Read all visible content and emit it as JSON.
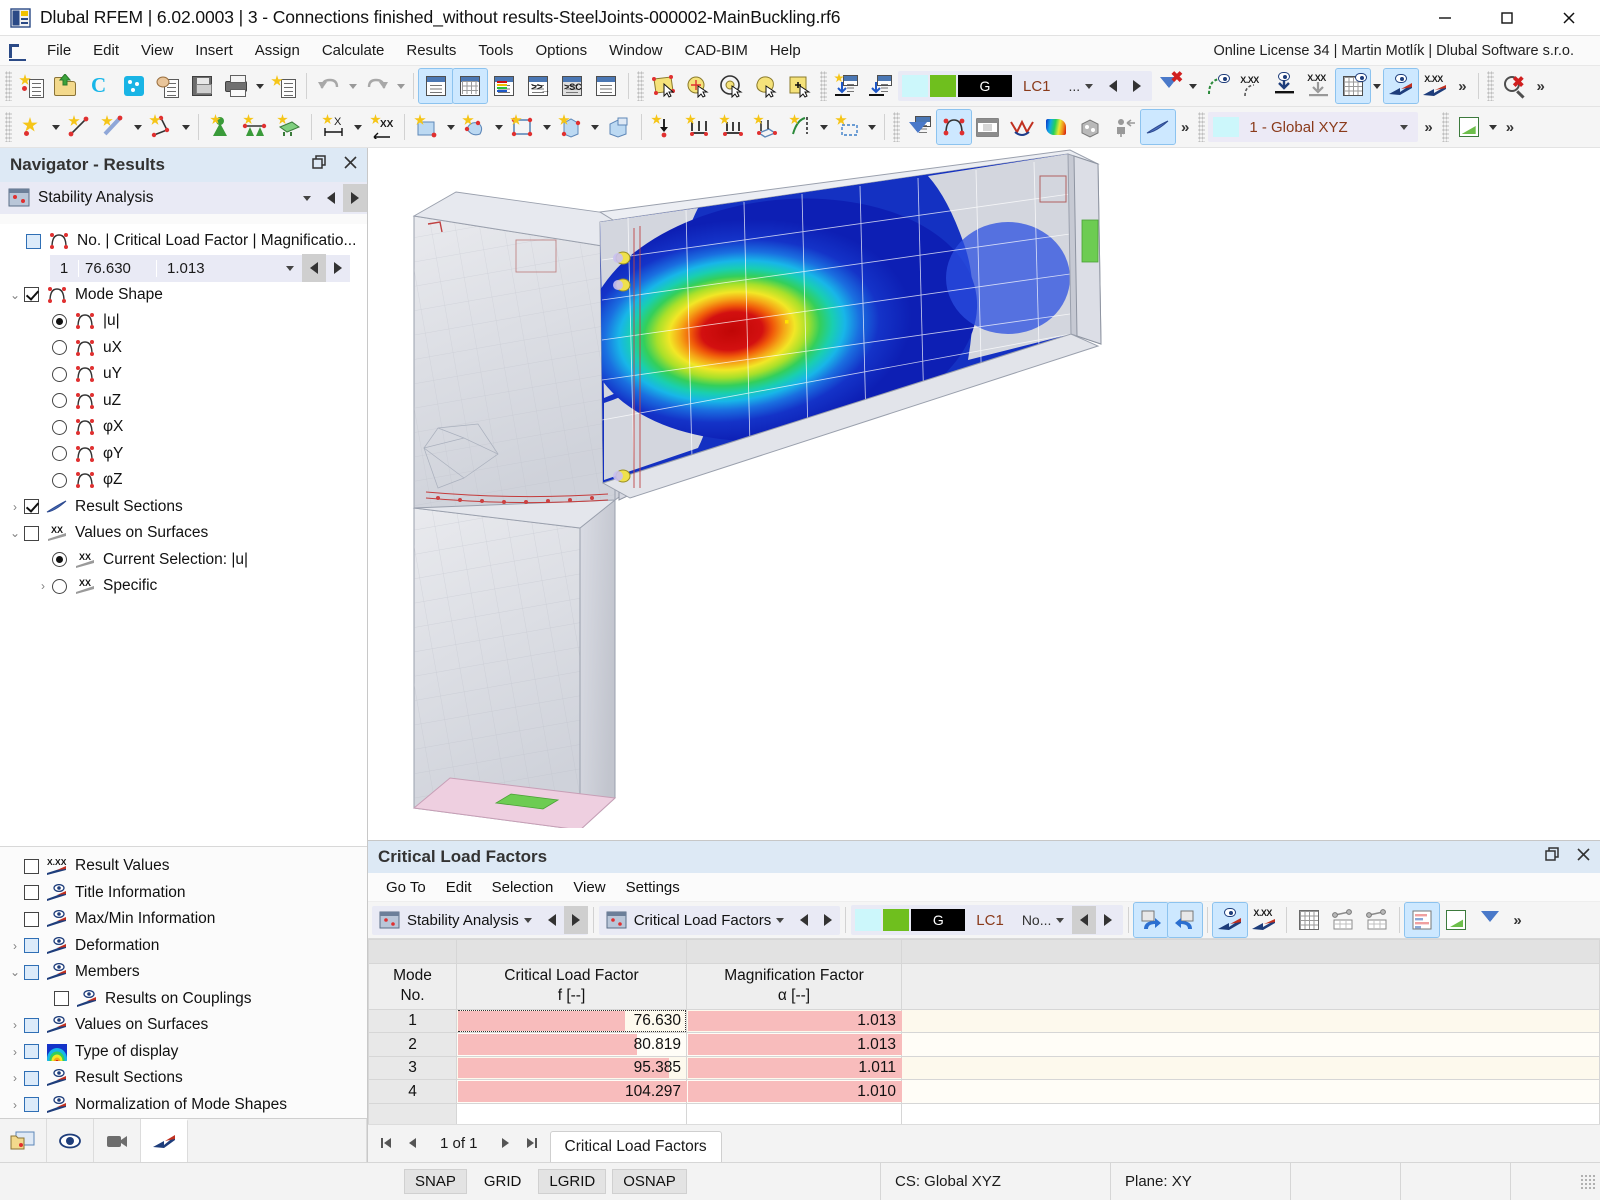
{
  "window": {
    "title": "Dlubal RFEM | 6.02.0003 | 3 - Connections finished_without results-SteelJoints-000002-MainBuckling.rf6",
    "minimize_label": "—",
    "maximize_label": "□",
    "close_label": "✕"
  },
  "menubar": {
    "items": [
      "File",
      "Edit",
      "View",
      "Insert",
      "Assign",
      "Calculate",
      "Results",
      "Tools",
      "Options",
      "Window",
      "CAD-BIM",
      "Help"
    ],
    "license": "Online License 34 | Martin Motlík | Dlubal Software s.r.o."
  },
  "toolbar": {
    "load_case": "LC1",
    "load_case_group": "G",
    "more_options": "...",
    "coordinate_system": "1 - Global XYZ",
    "overflow": "»"
  },
  "navigator": {
    "title": "Navigator - Results",
    "restore_icon": "restore-icon",
    "close_icon": "close-icon",
    "analysis_type": "Stability Analysis",
    "mode_header": "No. | Critical Load Factor | Magnificatio...",
    "selected_mode": {
      "no": "1",
      "critical_load_factor": "76.630",
      "magnification_factor": "1.013"
    },
    "tree": [
      {
        "label": "Mode Shape",
        "type": "checkbox",
        "checked": true,
        "expander": "⌄",
        "indent": 0,
        "icon": "member-icon"
      },
      {
        "label": "|u|",
        "type": "radio",
        "checked": true,
        "indent": 1,
        "icon": "member-icon"
      },
      {
        "label": "uX",
        "type": "radio",
        "checked": false,
        "indent": 1,
        "icon": "member-icon"
      },
      {
        "label": "uY",
        "type": "radio",
        "checked": false,
        "indent": 1,
        "icon": "member-icon"
      },
      {
        "label": "uZ",
        "type": "radio",
        "checked": false,
        "indent": 1,
        "icon": "member-icon"
      },
      {
        "label": "φX",
        "type": "radio",
        "checked": false,
        "indent": 1,
        "icon": "member-icon"
      },
      {
        "label": "φY",
        "type": "radio",
        "checked": false,
        "indent": 1,
        "icon": "member-icon"
      },
      {
        "label": "φZ",
        "type": "radio",
        "checked": false,
        "indent": 1,
        "icon": "member-icon"
      },
      {
        "label": "Result Sections",
        "type": "checkbox",
        "checked": true,
        "expander": "›",
        "indent": 0,
        "icon": "result-section-icon"
      },
      {
        "label": "Values on Surfaces",
        "type": "checkbox",
        "checked": false,
        "expander": "⌄",
        "indent": 0,
        "icon": "xx-icon"
      },
      {
        "label": "Current Selection: |u|",
        "type": "radio",
        "checked": true,
        "indent": 1,
        "icon": "xx-icon"
      },
      {
        "label": "Specific",
        "type": "radio",
        "checked": false,
        "expander": "›",
        "indent": 1,
        "icon": "xx-icon"
      }
    ],
    "lower_tree": [
      {
        "label": "Result Values",
        "checked": false,
        "blue": false,
        "expander": "",
        "indent": 0,
        "icon": "xxx-curve-icon"
      },
      {
        "label": "Title Information",
        "checked": false,
        "blue": false,
        "expander": "",
        "indent": 0,
        "icon": "eye-curve-icon"
      },
      {
        "label": "Max/Min Information",
        "checked": false,
        "blue": false,
        "expander": "",
        "indent": 0,
        "icon": "eye-curve-icon"
      },
      {
        "label": "Deformation",
        "checked": false,
        "blue": true,
        "expander": "›",
        "indent": 0,
        "icon": "eye-curve-icon"
      },
      {
        "label": "Members",
        "checked": false,
        "blue": true,
        "expander": "⌄",
        "indent": 0,
        "icon": "eye-curve-icon"
      },
      {
        "label": "Results on Couplings",
        "checked": false,
        "blue": false,
        "expander": "",
        "indent": 1,
        "icon": "eye-curve-icon"
      },
      {
        "label": "Values on Surfaces",
        "checked": false,
        "blue": true,
        "expander": "›",
        "indent": 0,
        "icon": "eye-curve-icon"
      },
      {
        "label": "Type of display",
        "checked": false,
        "blue": true,
        "expander": "›",
        "indent": 0,
        "icon": "rainbow-icon"
      },
      {
        "label": "Result Sections",
        "checked": false,
        "blue": true,
        "expander": "›",
        "indent": 0,
        "icon": "eye-curve-icon"
      },
      {
        "label": "Normalization of Mode Shapes",
        "checked": false,
        "blue": true,
        "expander": "›",
        "indent": 0,
        "icon": "eye-curve-icon"
      }
    ],
    "bottom_buttons": [
      "project-navigator-icon",
      "view-navigator-icon",
      "camera-icon",
      "results-navigator-icon"
    ]
  },
  "table_panel": {
    "title": "Critical Load Factors",
    "restore_icon": "restore-icon",
    "close_icon": "close-icon",
    "menu": [
      "Go To",
      "Edit",
      "Selection",
      "View",
      "Settings"
    ],
    "analysis_combo": "Stability Analysis",
    "table_combo": "Critical Load Factors",
    "load_case": "LC1",
    "load_case_group": "G",
    "no_label": "No...",
    "columns": [
      {
        "line1": "Mode",
        "line2": "No."
      },
      {
        "line1": "Critical Load Factor",
        "line2": "f [--]"
      },
      {
        "line1": "Magnification Factor",
        "line2": "α [--]"
      },
      {
        "line1": "",
        "line2": ""
      }
    ],
    "rows": [
      {
        "mode": "1",
        "critical_load_factor": "76.630",
        "magnification_factor": "1.013",
        "clf_bar_pct": 73,
        "mag_bar_pct": 100,
        "selected": true
      },
      {
        "mode": "2",
        "critical_load_factor": "80.819",
        "magnification_factor": "1.013",
        "clf_bar_pct": 78,
        "mag_bar_pct": 100,
        "selected": false
      },
      {
        "mode": "3",
        "critical_load_factor": "95.385",
        "magnification_factor": "1.011",
        "clf_bar_pct": 92,
        "mag_bar_pct": 100,
        "selected": false
      },
      {
        "mode": "4",
        "critical_load_factor": "104.297",
        "magnification_factor": "1.010",
        "clf_bar_pct": 100,
        "mag_bar_pct": 100,
        "selected": false
      }
    ],
    "pager": {
      "first": "⏮",
      "prev": "◀",
      "text": "1 of 1",
      "next": "▶",
      "last": "⏭"
    },
    "sheet_tab": "Critical Load Factors"
  },
  "statusbar": {
    "toggles": [
      "SNAP",
      "GRID",
      "LGRID",
      "OSNAP"
    ],
    "coordinate_system": "CS: Global XYZ",
    "plane": "Plane: XY"
  }
}
